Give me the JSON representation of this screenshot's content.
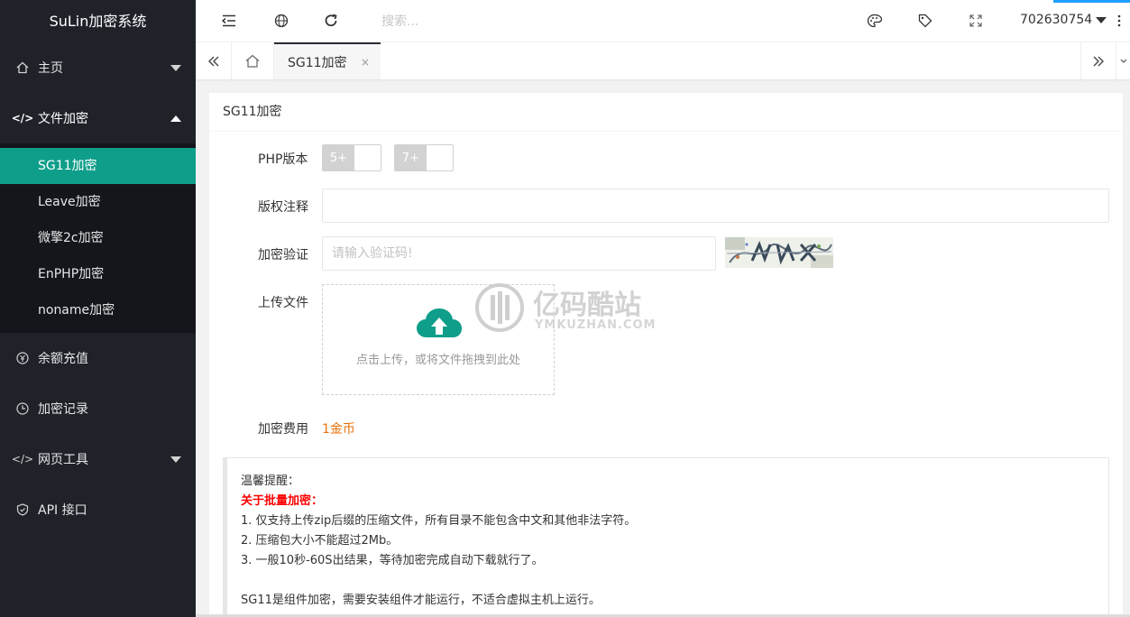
{
  "app": {
    "title": "SuLin加密系统"
  },
  "sidebar": {
    "items": [
      {
        "label": "主页",
        "icon": "home-icon"
      },
      {
        "label": "文件加密",
        "icon": "code-icon"
      },
      {
        "label": "余额充值",
        "icon": "yen-icon"
      },
      {
        "label": "加密记录",
        "icon": "clock-icon"
      },
      {
        "label": "网页工具",
        "icon": "code-icon"
      },
      {
        "label": "API 接口",
        "icon": "shield-icon"
      }
    ],
    "submenu": [
      "SG11加密",
      "Leave加密",
      "微擎2c加密",
      "EnPHP加密",
      "noname加密"
    ]
  },
  "header": {
    "search_placeholder": "搜索...",
    "username": "702630754"
  },
  "tabs": {
    "active_label": "SG11加密",
    "close": "×"
  },
  "form": {
    "card_title": "SG11加密",
    "php_label": "PHP版本",
    "php_options": [
      "5+",
      "7+"
    ],
    "copyright_label": "版权注释",
    "copyright_value": "",
    "verify_label": "加密验证",
    "verify_placeholder": "请输入验证码!",
    "upload_label": "上传文件",
    "upload_text": "点击上传，或将文件拖拽到此处",
    "cost_label": "加密费用",
    "cost_value": "1金币"
  },
  "tips": {
    "heading": "温馨提醒：",
    "batch_title": "关于批量加密：",
    "lines": [
      "1. 仅支持上传zip后缀的压缩文件，所有目录不能包含中文和其他非法字符。",
      "2. 压缩包大小不能超过2Mb。",
      "3. 一般10秒-60S出结果，等待加密完成自动下载就行了。"
    ],
    "note": "SG11是组件加密，需要安装组件才能运行，不适合虚拟主机上运行。"
  },
  "watermark": {
    "cn": "亿码酷站",
    "en": "YMKUZHAN.COM"
  },
  "colors": {
    "accent": "#0f9e8a",
    "sidebar": "#20222a",
    "cost": "#e8710a",
    "red": "#ff0000"
  }
}
